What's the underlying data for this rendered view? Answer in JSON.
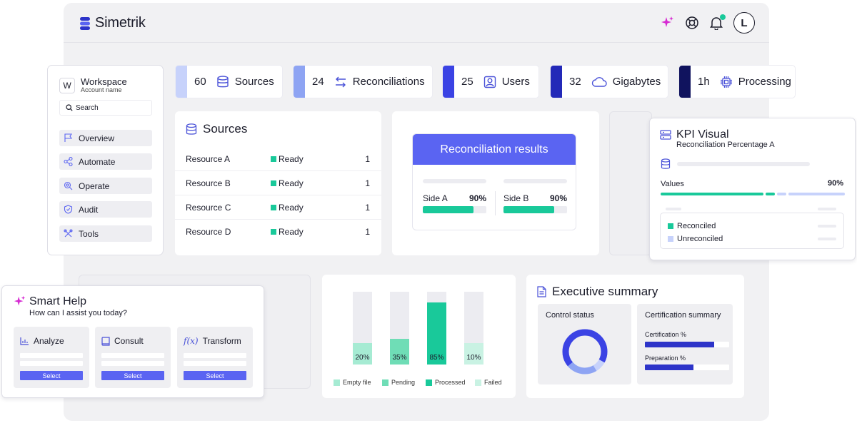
{
  "header": {
    "brand": "Simetrik",
    "avatar_letter": "L"
  },
  "colors": {
    "accent": "#5a64f2",
    "green": "#19c99a",
    "navy": "#2d34c9",
    "magenta": "#d62ad2"
  },
  "sidebar": {
    "workspace": "Workspace",
    "workspace_badge": "W",
    "account": "Account name",
    "search_placeholder": "Search",
    "items": [
      {
        "label": "Overview",
        "icon": "flag-icon"
      },
      {
        "label": "Automate",
        "icon": "network-icon"
      },
      {
        "label": "Operate",
        "icon": "search-gear-icon"
      },
      {
        "label": "Audit",
        "icon": "shield-icon"
      },
      {
        "label": "Tools",
        "icon": "tools-icon"
      }
    ]
  },
  "stats": [
    {
      "value": "60",
      "label": "Sources",
      "color": "#c7d2fb"
    },
    {
      "value": "24",
      "label": "Reconciliations",
      "color": "#8ea4f3"
    },
    {
      "value": "25",
      "label": "Users",
      "color": "#3b43e4"
    },
    {
      "value": "32",
      "label": "Gigabytes",
      "color": "#2329b8"
    },
    {
      "value": "1h",
      "label": "Processing",
      "color": "#10135e"
    }
  ],
  "sources": {
    "title": "Sources",
    "rows": [
      {
        "name": "Resource A",
        "status": "Ready",
        "count": "1"
      },
      {
        "name": "Resource B",
        "status": "Ready",
        "count": "1"
      },
      {
        "name": "Resource C",
        "status": "Ready",
        "count": "1"
      },
      {
        "name": "Resource D",
        "status": "Ready",
        "count": "1"
      }
    ]
  },
  "reconciliation": {
    "title": "Reconciliation results",
    "side_a": {
      "label": "Side A",
      "value": "90%",
      "fraction": 0.8
    },
    "side_b": {
      "label": "Side B",
      "value": "90%",
      "fraction": 0.8
    }
  },
  "kpi": {
    "title": "KPI Visual",
    "subtitle": "Reconciliation Percentage A",
    "values_label": "Values",
    "values_pct": "90%",
    "legend": [
      "Reconciled",
      "Unreconciled"
    ]
  },
  "chart_data": {
    "type": "bar",
    "categories": [
      "Empty file",
      "Pending",
      "Processed",
      "Failed"
    ],
    "values": [
      20,
      35,
      85,
      10
    ],
    "labels": [
      "20%",
      "35%",
      "85%",
      "10%"
    ],
    "ylim": [
      0,
      100
    ],
    "colors": [
      "#a6ebd3",
      "#6fddb6",
      "#19c99a",
      "#c9f2e3"
    ],
    "legend": "bottom"
  },
  "exec": {
    "title": "Executive summary",
    "control_status": "Control status",
    "certification_summary": "Certification summary",
    "cert_label": "Certification %",
    "cert_value": 0.82,
    "prep_label": "Preparation %",
    "prep_value": 0.58
  },
  "help": {
    "title": "Smart Help",
    "subtitle": "How can I assist you today?",
    "options": [
      {
        "label": "Analyze",
        "button": "Select",
        "icon": "bar-chart-icon"
      },
      {
        "label": "Consult",
        "button": "Select",
        "icon": "book-icon"
      },
      {
        "label": "Transform",
        "button": "Select",
        "icon": "function-icon"
      }
    ]
  }
}
